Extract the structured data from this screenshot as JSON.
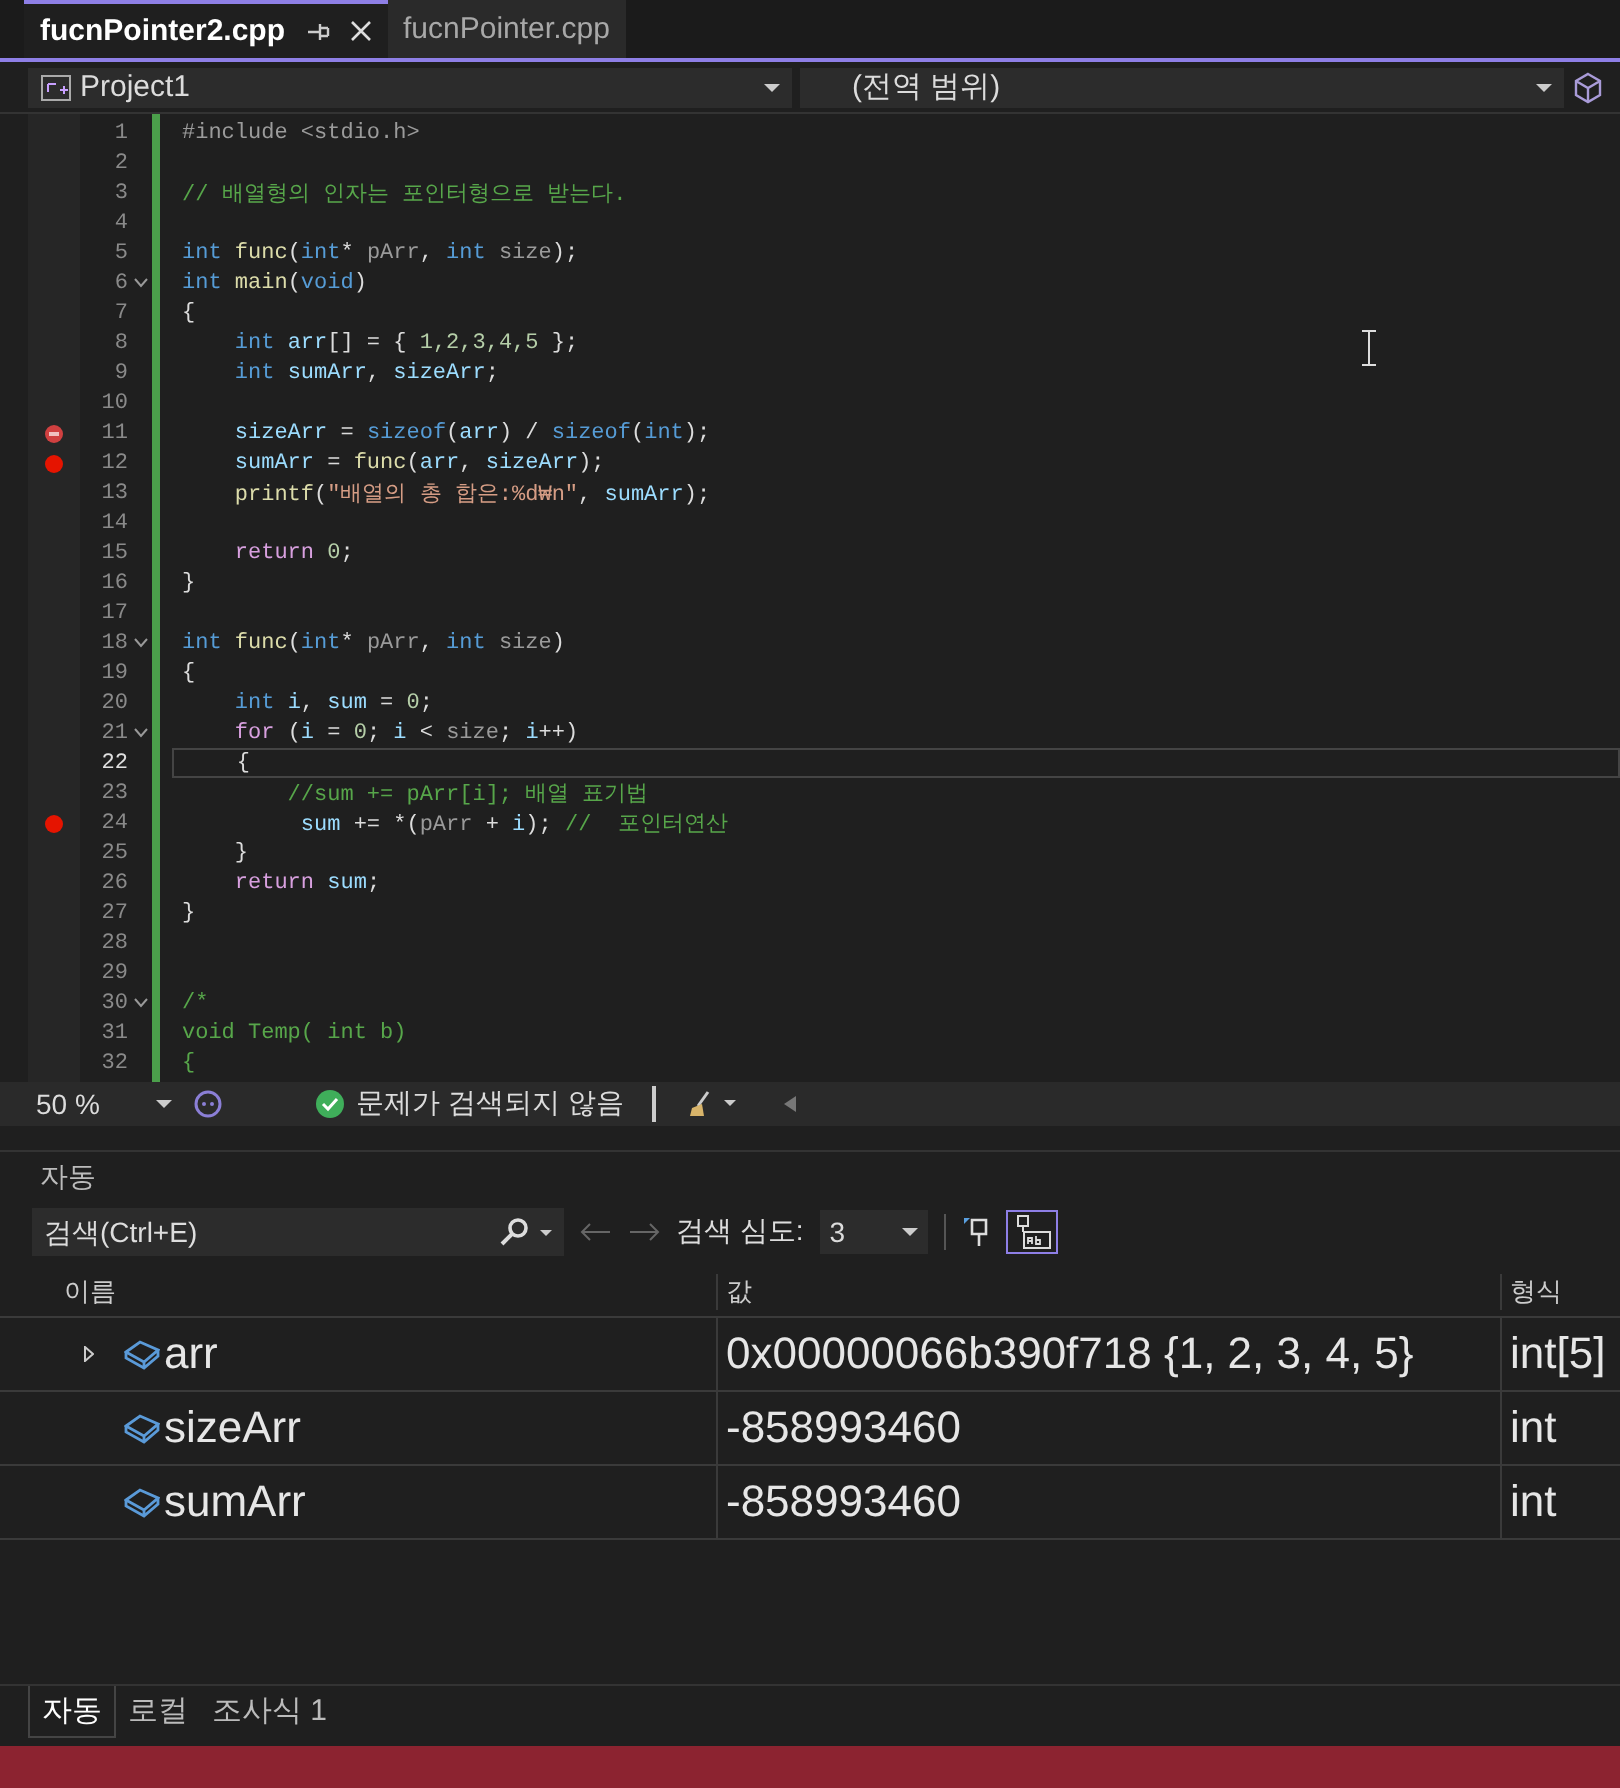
{
  "editor_tabs": [
    {
      "label": "fucnPointer2.cpp",
      "selected": true
    },
    {
      "label": "fucnPointer.cpp",
      "selected": false
    }
  ],
  "nav_bar": {
    "project": "Project1",
    "scope": "(전역 범위)"
  },
  "code_lines": [
    {
      "number": "1",
      "tokens": [
        {
          "text": "#include <stdio.h>",
          "kind": "pre"
        }
      ]
    },
    {
      "number": "2"
    },
    {
      "number": "3",
      "tokens": [
        {
          "text": "// 배열형의 인자는 포인터형으로 받는다.",
          "kind": "comment"
        }
      ]
    },
    {
      "number": "4"
    },
    {
      "number": "5",
      "tokens": [
        {
          "text": "int ",
          "kind": "keyword"
        },
        {
          "text": "func",
          "kind": "function"
        },
        {
          "text": "(",
          "kind": "plain"
        },
        {
          "text": "int",
          "kind": "keyword"
        },
        {
          "text": "* ",
          "kind": "plain"
        },
        {
          "text": "pArr",
          "kind": "param"
        },
        {
          "text": ", ",
          "kind": "plain"
        },
        {
          "text": "int ",
          "kind": "keyword"
        },
        {
          "text": "size",
          "kind": "param"
        },
        {
          "text": ");",
          "kind": "plain"
        }
      ]
    },
    {
      "number": "6",
      "foldable": true,
      "tokens": [
        {
          "text": "int ",
          "kind": "keyword"
        },
        {
          "text": "main",
          "kind": "function"
        },
        {
          "text": "(",
          "kind": "plain"
        },
        {
          "text": "void",
          "kind": "keyword"
        },
        {
          "text": ")",
          "kind": "plain"
        }
      ]
    },
    {
      "number": "7",
      "tokens": [
        {
          "text": "{",
          "kind": "plain"
        }
      ]
    },
    {
      "number": "8",
      "tokens": [
        {
          "text": "    int ",
          "kind": "keyword"
        },
        {
          "text": "arr",
          "kind": "ident"
        },
        {
          "text": "[] = { ",
          "kind": "plain"
        },
        {
          "text": "1,2,3,4,5",
          "kind": "number"
        },
        {
          "text": " };",
          "kind": "plain"
        }
      ]
    },
    {
      "number": "9",
      "tokens": [
        {
          "text": "    int ",
          "kind": "keyword"
        },
        {
          "text": "sumArr",
          "kind": "ident"
        },
        {
          "text": ", ",
          "kind": "plain"
        },
        {
          "text": "sizeArr",
          "kind": "ident"
        },
        {
          "text": ";",
          "kind": "plain"
        }
      ]
    },
    {
      "number": "10"
    },
    {
      "number": "11",
      "breakpoint": true,
      "warning": true,
      "tokens": [
        {
          "text": "    sizeArr",
          "kind": "ident"
        },
        {
          "text": " = ",
          "kind": "plain"
        },
        {
          "text": "sizeof",
          "kind": "keyword"
        },
        {
          "text": "(",
          "kind": "plain"
        },
        {
          "text": "arr",
          "kind": "ident"
        },
        {
          "text": ") / ",
          "kind": "plain"
        },
        {
          "text": "sizeof",
          "kind": "keyword"
        },
        {
          "text": "(",
          "kind": "plain"
        },
        {
          "text": "int",
          "kind": "keyword"
        },
        {
          "text": ");",
          "kind": "plain"
        }
      ]
    },
    {
      "number": "12",
      "breakpoint": true,
      "warning": false,
      "tokens": [
        {
          "text": "    sumArr",
          "kind": "ident"
        },
        {
          "text": " = ",
          "kind": "plain"
        },
        {
          "text": "func",
          "kind": "function"
        },
        {
          "text": "(",
          "kind": "plain"
        },
        {
          "text": "arr",
          "kind": "ident"
        },
        {
          "text": ", ",
          "kind": "plain"
        },
        {
          "text": "sizeArr",
          "kind": "ident"
        },
        {
          "text": ");",
          "kind": "plain"
        }
      ]
    },
    {
      "number": "13",
      "tokens": [
        {
          "text": "    printf",
          "kind": "function"
        },
        {
          "text": "(",
          "kind": "plain"
        },
        {
          "text": "\"배열의 총 합은:%d₩n\"",
          "kind": "string"
        },
        {
          "text": ", ",
          "kind": "plain"
        },
        {
          "text": "sumArr",
          "kind": "ident"
        },
        {
          "text": ");",
          "kind": "plain"
        }
      ]
    },
    {
      "number": "14"
    },
    {
      "number": "15",
      "tokens": [
        {
          "text": "    return ",
          "kind": "control"
        },
        {
          "text": "0",
          "kind": "number"
        },
        {
          "text": ";",
          "kind": "plain"
        }
      ]
    },
    {
      "number": "16",
      "tokens": [
        {
          "text": "}",
          "kind": "plain"
        }
      ]
    },
    {
      "number": "17"
    },
    {
      "number": "18",
      "foldable": true,
      "tokens": [
        {
          "text": "int ",
          "kind": "keyword"
        },
        {
          "text": "func",
          "kind": "function"
        },
        {
          "text": "(",
          "kind": "plain"
        },
        {
          "text": "int",
          "kind": "keyword"
        },
        {
          "text": "* ",
          "kind": "plain"
        },
        {
          "text": "pArr",
          "kind": "param"
        },
        {
          "text": ", ",
          "kind": "plain"
        },
        {
          "text": "int ",
          "kind": "keyword"
        },
        {
          "text": "size",
          "kind": "param"
        },
        {
          "text": ")",
          "kind": "plain"
        }
      ]
    },
    {
      "number": "19",
      "tokens": [
        {
          "text": "{",
          "kind": "plain"
        }
      ]
    },
    {
      "number": "20",
      "tokens": [
        {
          "text": "    int ",
          "kind": "keyword"
        },
        {
          "text": "i",
          "kind": "ident"
        },
        {
          "text": ", ",
          "kind": "plain"
        },
        {
          "text": "sum",
          "kind": "ident"
        },
        {
          "text": " = ",
          "kind": "plain"
        },
        {
          "text": "0",
          "kind": "number"
        },
        {
          "text": ";",
          "kind": "plain"
        }
      ]
    },
    {
      "number": "21",
      "foldable": true,
      "tokens": [
        {
          "text": "    for",
          "kind": "control"
        },
        {
          "text": " (",
          "kind": "plain"
        },
        {
          "text": "i",
          "kind": "ident"
        },
        {
          "text": " = ",
          "kind": "plain"
        },
        {
          "text": "0",
          "kind": "number"
        },
        {
          "text": "; ",
          "kind": "plain"
        },
        {
          "text": "i",
          "kind": "ident"
        },
        {
          "text": " < ",
          "kind": "plain"
        },
        {
          "text": "size",
          "kind": "param"
        },
        {
          "text": "; ",
          "kind": "plain"
        },
        {
          "text": "i",
          "kind": "ident"
        },
        {
          "text": "++)",
          "kind": "plain"
        }
      ]
    },
    {
      "number": "22",
      "current": true,
      "tokens": [
        {
          "text": "    {",
          "kind": "plain"
        }
      ]
    },
    {
      "number": "23",
      "tokens": [
        {
          "text": "        //sum += pArr[i]; 배열 표기법",
          "kind": "comment"
        }
      ]
    },
    {
      "number": "24",
      "breakpoint": true,
      "warning": false,
      "tokens": [
        {
          "text": "         sum",
          "kind": "ident"
        },
        {
          "text": " += *(",
          "kind": "plain"
        },
        {
          "text": "pArr",
          "kind": "param"
        },
        {
          "text": " + ",
          "kind": "plain"
        },
        {
          "text": "i",
          "kind": "ident"
        },
        {
          "text": "); ",
          "kind": "plain"
        },
        {
          "text": "//  포인터연산",
          "kind": "comment"
        }
      ]
    },
    {
      "number": "25",
      "tokens": [
        {
          "text": "    }",
          "kind": "plain"
        }
      ]
    },
    {
      "number": "26",
      "tokens": [
        {
          "text": "    return ",
          "kind": "control"
        },
        {
          "text": "sum",
          "kind": "ident"
        },
        {
          "text": ";",
          "kind": "plain"
        }
      ]
    },
    {
      "number": "27",
      "tokens": [
        {
          "text": "}",
          "kind": "plain"
        }
      ]
    },
    {
      "number": "28"
    },
    {
      "number": "29"
    },
    {
      "number": "30",
      "foldable": true,
      "tokens": [
        {
          "text": "/*",
          "kind": "comment"
        }
      ]
    },
    {
      "number": "31",
      "tokens": [
        {
          "text": "void Temp( int b)",
          "kind": "comment"
        }
      ]
    },
    {
      "number": "32",
      "tokens": [
        {
          "text": "{",
          "kind": "comment"
        }
      ]
    }
  ],
  "editor_status": {
    "zoom": "50 %",
    "issues": "문제가 검색되지 않음"
  },
  "autos_panel": {
    "title": "자동",
    "search": {
      "placeholder": "검색(Ctrl+E)"
    },
    "depth_label": "검색 심도:",
    "depth_value": "3",
    "columns": [
      "이름",
      "값",
      "형식"
    ],
    "rows": [
      {
        "name": "arr",
        "value": "0x00000066b390f718 {1, 2, 3, 4, 5}",
        "type": "int[5]",
        "expandable": true
      },
      {
        "name": "sizeArr",
        "value": "-858993460",
        "type": "int",
        "expandable": false
      },
      {
        "name": "sumArr",
        "value": "-858993460",
        "type": "int",
        "expandable": false
      }
    ],
    "tabs": [
      {
        "label": "자동",
        "selected": true
      },
      {
        "label": "로컬",
        "selected": false
      },
      {
        "label": "조사식 1",
        "selected": false
      }
    ]
  }
}
